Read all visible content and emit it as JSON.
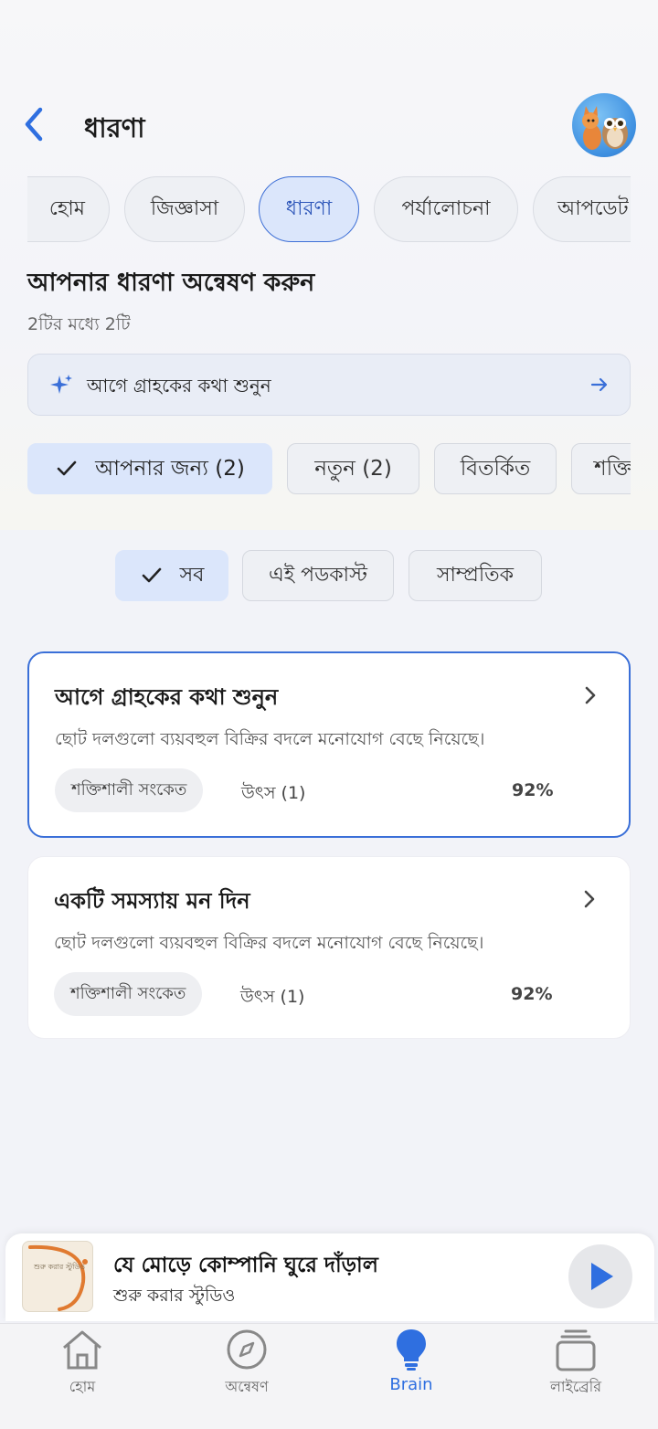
{
  "header": {
    "title": "ধারণা",
    "back_icon": "chevron-left-icon"
  },
  "nav_tabs": [
    {
      "label": "হোম",
      "active": false
    },
    {
      "label": "জিজ্ঞাসা",
      "active": false
    },
    {
      "label": "ধারণা",
      "active": true
    },
    {
      "label": "পর্যালোচনা",
      "active": false
    },
    {
      "label": "আপডেট",
      "active": false
    }
  ],
  "section": {
    "title": "আপনার ধারণা অন্বেষণ করুন",
    "subtitle": "2টির মধ্যে 2টি"
  },
  "banner": {
    "text": "আগে গ্রাহকের কথা শুনুন",
    "icon": "sparkle-icon",
    "arrow_icon": "arrow-right-icon"
  },
  "filters": [
    {
      "label": "আপনার জন্য (2)",
      "active": true
    },
    {
      "label": "নতুন (2)",
      "active": false
    },
    {
      "label": "বিতর্কিত",
      "active": false
    },
    {
      "label": "শক্তি",
      "active": false
    }
  ],
  "scope": [
    {
      "label": "সব",
      "active": true
    },
    {
      "label": "এই পডকাস্ট",
      "active": false
    },
    {
      "label": "সাম্প্রতিক",
      "active": false
    }
  ],
  "cards": [
    {
      "title": "আগে গ্রাহকের কথা শুনুন",
      "description": "ছোট দলগুলো ব্যয়বহুল বিক্রির বদলে মনোযোগ বেছে নিয়েছে।",
      "badge": "শক্তিশালী সংকেত",
      "source": "উৎস (1)",
      "percent": "92%"
    },
    {
      "title": "একটি সমস্যায় মন দিন",
      "description": "ছোট দলগুলো ব্যয়বহুল বিক্রির বদলে মনোযোগ বেছে নিয়েছে।",
      "badge": "শক্তিশালী সংকেত",
      "source": "উৎস (1)",
      "percent": "92%"
    }
  ],
  "player": {
    "title": "যে মোড়ে কোম্পানি ঘুরে দাঁড়াল",
    "subtitle": "শুরু করার স্টুডিও",
    "thumb_text": "শুরু করার স্টুডিও"
  },
  "bottom_nav": [
    {
      "label": "হোম",
      "icon": "home-icon",
      "active": false
    },
    {
      "label": "অন্বেষণ",
      "icon": "compass-icon",
      "active": false
    },
    {
      "label": "Brain",
      "icon": "lightbulb-icon",
      "active": true
    },
    {
      "label": "লাইব্রেরি",
      "icon": "library-icon",
      "active": false
    }
  ],
  "colors": {
    "accent": "#2f6fe0",
    "active_chip_bg": "#dbe6fb",
    "background": "#f2f3f8"
  }
}
